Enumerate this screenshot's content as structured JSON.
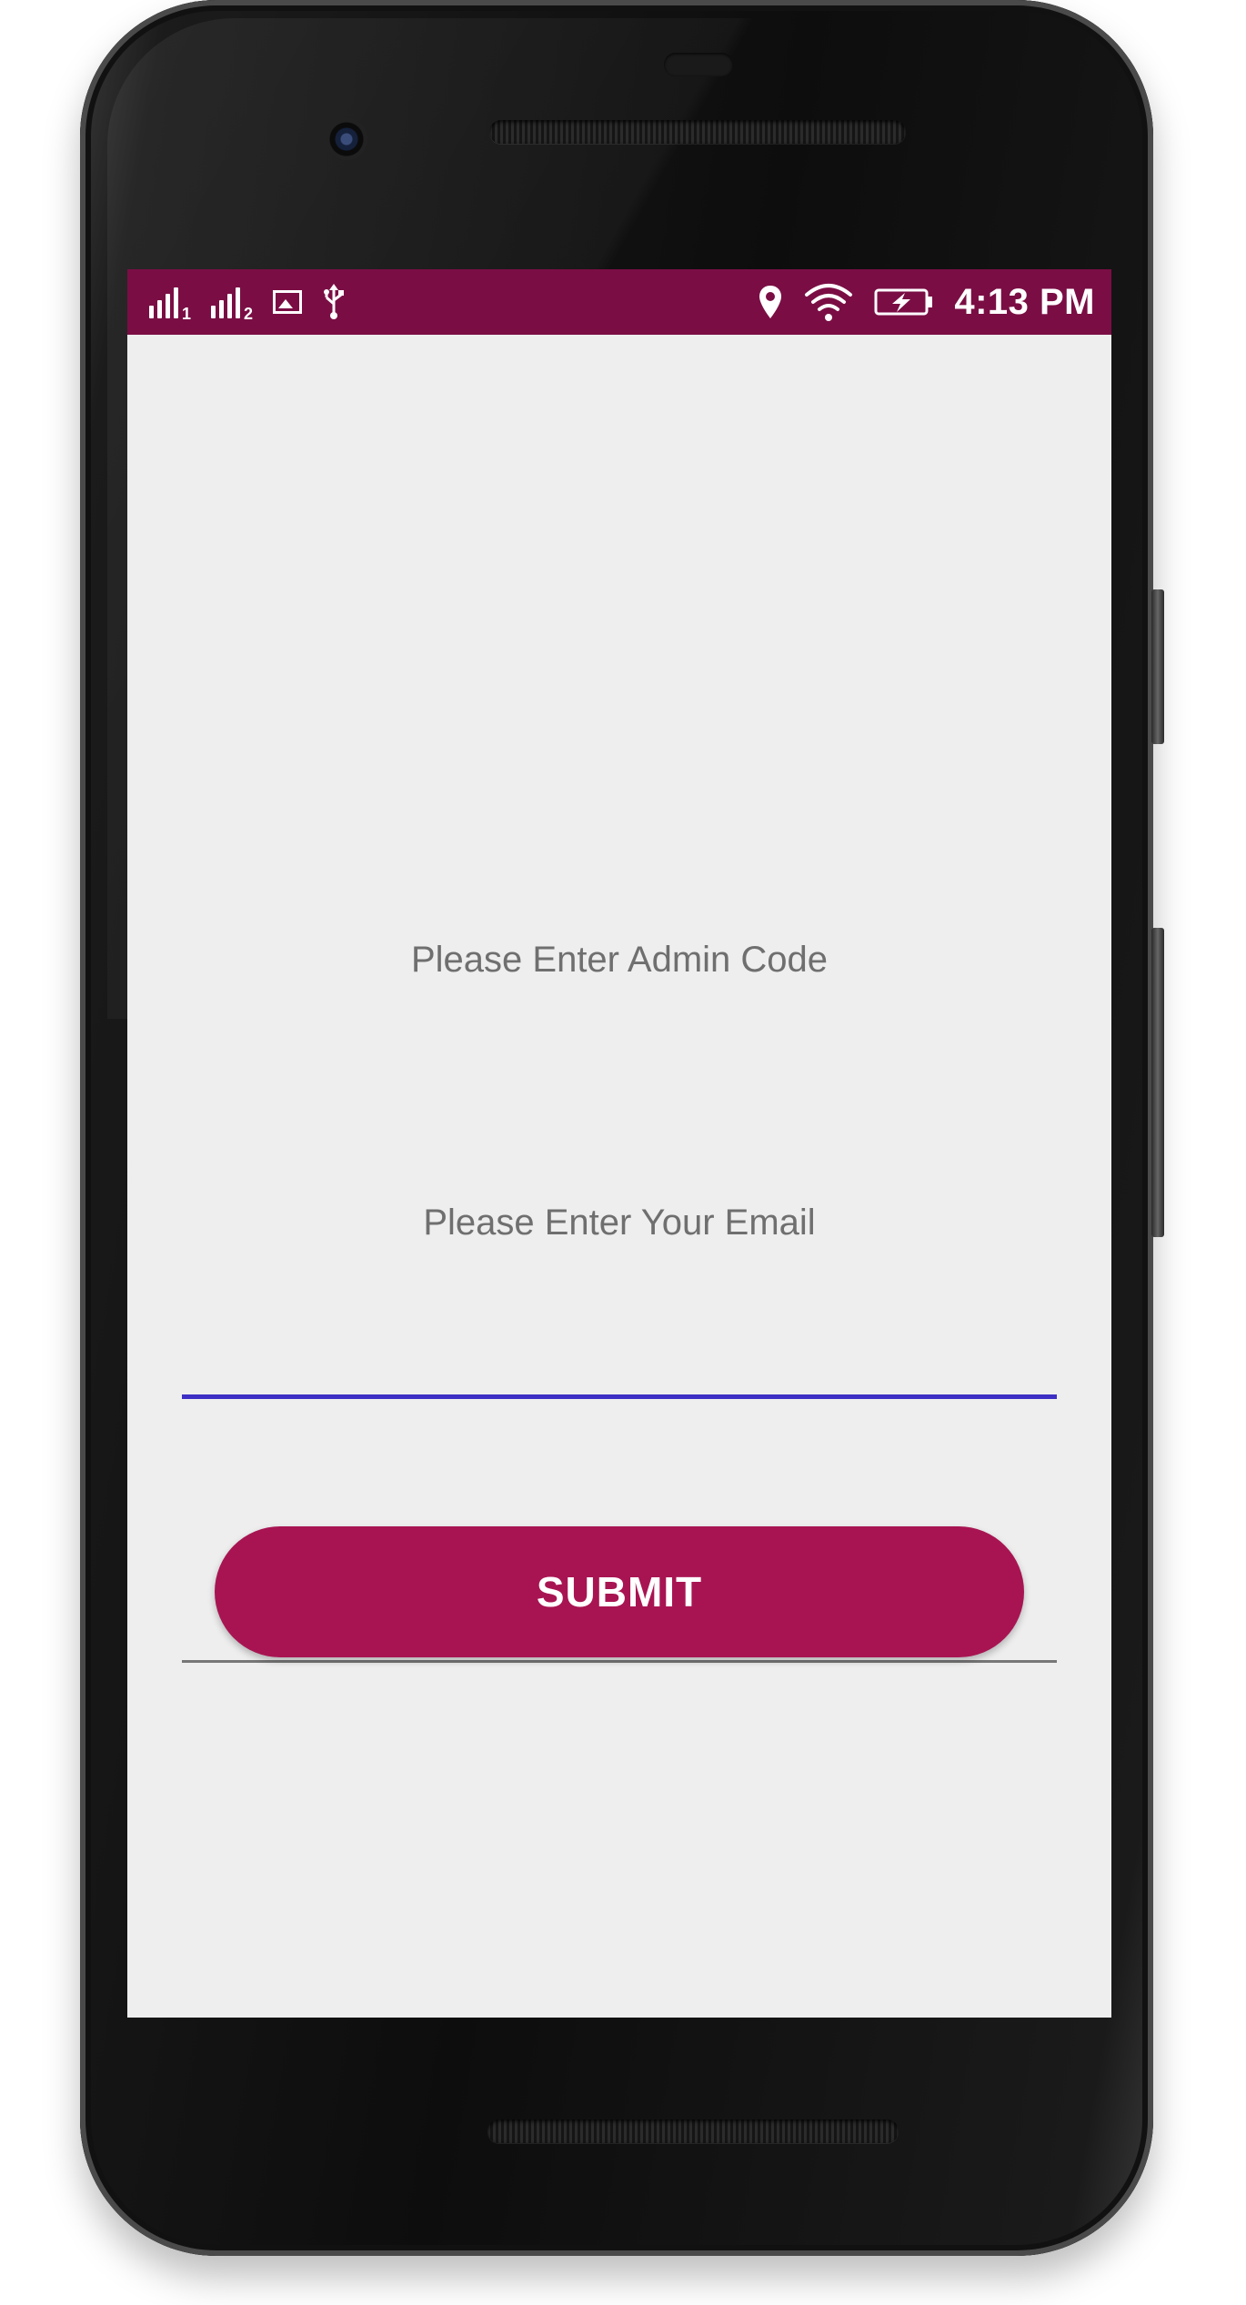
{
  "status_bar": {
    "sim1_label": "1",
    "sim2_label": "2",
    "time": "4:13 PM",
    "color": "#7a0e44",
    "icons": [
      "signal-sim1-icon",
      "signal-sim2-icon",
      "image-notification-icon",
      "usb-icon",
      "location-icon",
      "wifi-icon",
      "battery-charging-icon"
    ]
  },
  "form": {
    "admin_code_label": "Please Enter Admin Code",
    "admin_code_value": "",
    "email_label": "Please Enter Your Email",
    "email_value": "",
    "submit_label": "SUBMIT"
  },
  "colors": {
    "background": "#eeeeee",
    "accent_underline": "#3d2fc4",
    "submit_button": "#a81452"
  }
}
